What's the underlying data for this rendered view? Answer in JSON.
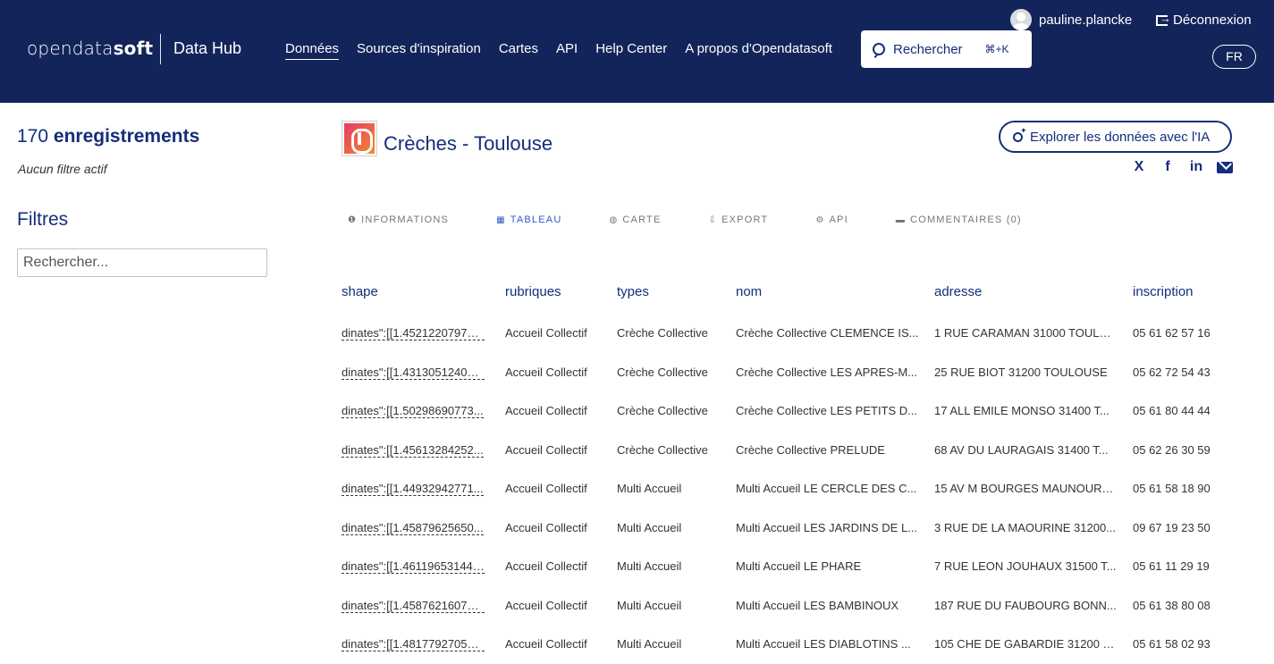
{
  "header": {
    "logo_light": "open",
    "logo_mid": "data",
    "logo_bold": "soft",
    "hub": "Data Hub",
    "nav": [
      "Données",
      "Sources d'inspiration",
      "Cartes",
      "API",
      "Help Center",
      "A propos d'Opendatasoft"
    ],
    "search_label": "Rechercher",
    "search_shortcut": "⌘+K",
    "username": "pauline.plancke",
    "logout": "Déconnexion",
    "lang": "FR"
  },
  "sidebar": {
    "count_number": "170",
    "count_label": "enregistrements",
    "no_filter": "Aucun filtre actif",
    "filters_title": "Filtres",
    "search_placeholder": "Rechercher..."
  },
  "dataset": {
    "title": "Crèches - Toulouse",
    "ai_button": "Explorer les données avec l'IA",
    "share": [
      "X",
      "f",
      "in",
      "mail"
    ]
  },
  "tabs": [
    {
      "icon": "❶",
      "label": "INFORMATIONS"
    },
    {
      "icon": "▦",
      "label": "TABLEAU"
    },
    {
      "icon": "◍",
      "label": "CARTE"
    },
    {
      "icon": "⇩",
      "label": "EXPORT"
    },
    {
      "icon": "⚙",
      "label": "API"
    },
    {
      "icon": "▬",
      "label": "COMMENTAIRES (0)"
    }
  ],
  "active_tab": "TABLEAU",
  "table": {
    "columns": [
      "shape",
      "rubriques",
      "types",
      "nom",
      "adresse",
      "inscription"
    ],
    "rows": [
      [
        "dinates\":[[1.452122079719...",
        "Accueil Collectif",
        "Crèche Collective",
        "Crèche Collective CLEMENCE IS...",
        "1 RUE CARAMAN 31000 TOULO...",
        "05 61 62 57 16"
      ],
      [
        "dinates\":[[1.431305124091...",
        "Accueil Collectif",
        "Crèche Collective",
        "Crèche Collective LES APRES-M...",
        "25 RUE BIOT 31200 TOULOUSE",
        "05 62 72 54 43"
      ],
      [
        "dinates\":[[1.50298690773...",
        "Accueil Collectif",
        "Crèche Collective",
        "Crèche Collective LES PETITS D...",
        "17 ALL EMILE MONSO 31400 T...",
        "05 61 80 44 44"
      ],
      [
        "dinates\":[[1.45613284252...",
        "Accueil Collectif",
        "Crèche Collective",
        "Crèche Collective PRELUDE",
        "68 AV DU LAURAGAIS 31400 T...",
        "05 62 26 30 59"
      ],
      [
        "dinates\":[[1.44932942771...",
        "Accueil Collectif",
        "Multi Accueil",
        "Multi Accueil LE CERCLE DES C...",
        "15 AV M BOURGES MAUNOURY...",
        "05 61 58 18 90"
      ],
      [
        "dinates\":[[1.45879625650...",
        "Accueil Collectif",
        "Multi Accueil",
        "Multi Accueil LES JARDINS DE L...",
        "3 RUE DE LA MAOURINE 31200...",
        "09 67 19 23 50"
      ],
      [
        "dinates\":[[1.461196531442...",
        "Accueil Collectif",
        "Multi Accueil",
        "Multi Accueil LE PHARE",
        "7 RUE LEON JOUHAUX 31500 T...",
        "05 61 11 29 19"
      ],
      [
        "dinates\":[[1.458762160757...",
        "Accueil Collectif",
        "Multi Accueil",
        "Multi Accueil LES BAMBINOUX",
        "187 RUE DU FAUBOURG BONN...",
        "05 61 38 80 08"
      ],
      [
        "dinates\":[[1.481779270501...",
        "Accueil Collectif",
        "Multi Accueil",
        "Multi Accueil LES DIABLOTINS ...",
        "105 CHE DE GABARDIE 31200 T...",
        "05 61 58 02 93"
      ]
    ]
  }
}
